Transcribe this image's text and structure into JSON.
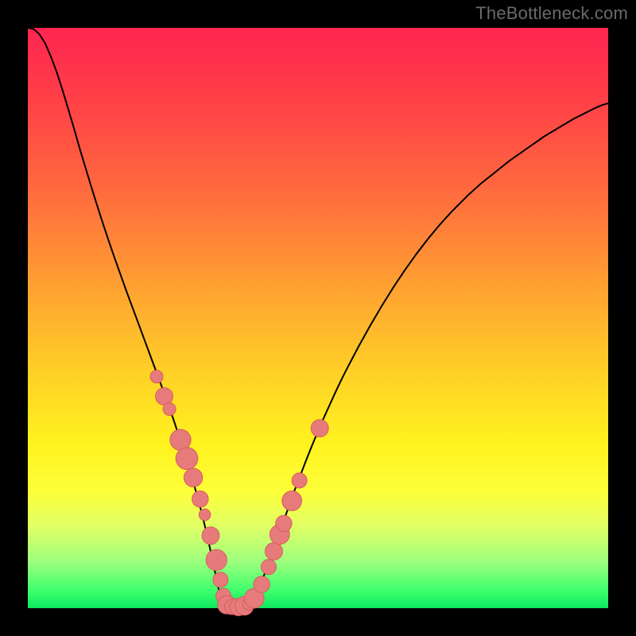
{
  "domain": "Chart",
  "watermark": "TheBottleneck.com",
  "colors": {
    "frame": "#000000",
    "curve": "#000000",
    "marker_fill": "#e77b7b",
    "marker_stroke": "#d65e5e",
    "gradient_top": "#ff2550",
    "gradient_bottom": "#0ce85e"
  },
  "chart_data": {
    "type": "line",
    "title": "",
    "xlabel": "",
    "ylabel": "",
    "xlim": [
      0,
      100
    ],
    "ylim": [
      0,
      100
    ],
    "x": [
      0,
      1,
      2,
      3,
      4,
      5,
      6,
      7,
      8,
      9,
      10,
      11,
      12,
      13,
      14,
      15,
      16,
      17,
      18,
      19,
      20,
      21,
      22,
      23,
      24,
      25,
      26,
      27,
      28,
      29,
      30,
      31,
      32,
      33,
      34,
      35,
      36,
      37,
      38,
      39,
      40,
      41,
      42,
      43,
      44,
      45,
      46,
      47,
      48,
      49,
      50,
      51,
      52,
      53,
      54,
      55,
      56,
      57,
      58,
      59,
      60,
      61,
      62,
      63,
      64,
      65,
      66,
      67,
      68,
      69,
      70,
      71,
      72,
      73,
      74,
      75,
      76,
      77,
      78,
      79,
      80,
      81,
      82,
      83,
      84,
      85,
      86,
      87,
      88,
      89,
      90,
      91,
      92,
      93,
      94,
      95,
      96,
      97,
      98,
      99,
      100
    ],
    "y": [
      100.0,
      99.8,
      98.9,
      97.3,
      95.0,
      92.3,
      89.2,
      85.9,
      82.5,
      79.0,
      75.7,
      72.4,
      69.2,
      66.1,
      63.1,
      60.2,
      57.4,
      54.6,
      51.9,
      49.2,
      46.5,
      43.8,
      41.1,
      38.4,
      35.6,
      32.8,
      29.8,
      26.7,
      23.5,
      20.0,
      16.3,
      12.1,
      7.5,
      2.7,
      0.5,
      0.2,
      0.2,
      0.3,
      0.9,
      2.1,
      4.0,
      6.4,
      9.1,
      11.9,
      14.8,
      17.6,
      20.4,
      23.0,
      25.6,
      28.1,
      30.5,
      32.8,
      35.0,
      37.2,
      39.3,
      41.3,
      43.2,
      45.1,
      46.9,
      48.7,
      50.4,
      52.1,
      53.7,
      55.3,
      56.8,
      58.3,
      59.7,
      61.1,
      62.4,
      63.7,
      64.9,
      66.1,
      67.2,
      68.3,
      69.3,
      70.3,
      71.3,
      72.2,
      73.1,
      73.9,
      74.7,
      75.5,
      76.3,
      77.1,
      77.8,
      78.5,
      79.2,
      79.9,
      80.6,
      81.3,
      81.9,
      82.5,
      83.1,
      83.7,
      84.3,
      84.8,
      85.3,
      85.8,
      86.3,
      86.7,
      87.0
    ],
    "markers": [
      {
        "x": 22.2,
        "y": 39.9,
        "r": 1.1
      },
      {
        "x": 23.5,
        "y": 36.5,
        "r": 1.5
      },
      {
        "x": 24.4,
        "y": 34.3,
        "r": 1.1
      },
      {
        "x": 26.3,
        "y": 29.0,
        "r": 1.8
      },
      {
        "x": 27.4,
        "y": 25.8,
        "r": 1.9
      },
      {
        "x": 28.5,
        "y": 22.5,
        "r": 1.6
      },
      {
        "x": 29.7,
        "y": 18.8,
        "r": 1.4
      },
      {
        "x": 30.5,
        "y": 16.1,
        "r": 1.0
      },
      {
        "x": 31.5,
        "y": 12.5,
        "r": 1.5
      },
      {
        "x": 32.5,
        "y": 8.3,
        "r": 1.8
      },
      {
        "x": 33.2,
        "y": 4.9,
        "r": 1.3
      },
      {
        "x": 33.7,
        "y": 2.1,
        "r": 1.3
      },
      {
        "x": 34.3,
        "y": 0.6,
        "r": 1.6
      },
      {
        "x": 35.2,
        "y": 0.2,
        "r": 1.3
      },
      {
        "x": 36.3,
        "y": 0.2,
        "r": 1.5
      },
      {
        "x": 37.3,
        "y": 0.4,
        "r": 1.6
      },
      {
        "x": 38.1,
        "y": 0.8,
        "r": 1.1
      },
      {
        "x": 39.0,
        "y": 1.7,
        "r": 1.7
      },
      {
        "x": 40.3,
        "y": 4.1,
        "r": 1.4
      },
      {
        "x": 41.5,
        "y": 7.1,
        "r": 1.3
      },
      {
        "x": 42.4,
        "y": 9.8,
        "r": 1.5
      },
      {
        "x": 43.4,
        "y": 12.7,
        "r": 1.7
      },
      {
        "x": 44.1,
        "y": 14.6,
        "r": 1.4
      },
      {
        "x": 45.5,
        "y": 18.5,
        "r": 1.7
      },
      {
        "x": 46.8,
        "y": 22.0,
        "r": 1.3
      },
      {
        "x": 50.3,
        "y": 31.0,
        "r": 1.5
      }
    ]
  }
}
